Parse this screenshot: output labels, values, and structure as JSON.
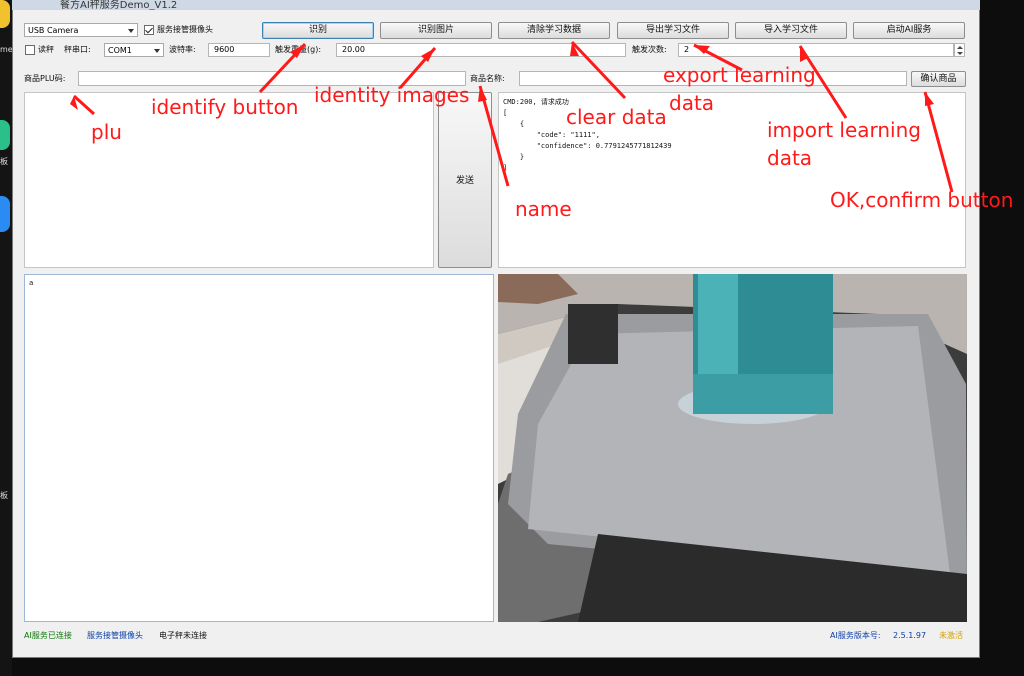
{
  "window": {
    "title": "餐方AI秤服务Demo_V1.2"
  },
  "toolbar": {
    "camera_select": "USB Camera",
    "service_camera_checkbox": {
      "label": "服务接管摄像头",
      "checked": true
    },
    "read_scale_checkbox": {
      "label": "读秤",
      "checked": false
    },
    "serial_port_label": "秤串口:",
    "serial_port_select": "COM1",
    "baud_rate_label": "波特率:",
    "baud_rate_value": "9600",
    "trigger_weight_label": "触发重量(g):",
    "trigger_weight_value": "20.00",
    "trigger_count_label": "触发次数:",
    "trigger_count_value": "2",
    "buttons": {
      "identify": "识别",
      "identify_image": "识别图片",
      "clear_data": "清除学习数据",
      "export_file": "导出学习文件",
      "import_file": "导入学习文件",
      "start_service": "启动AI服务"
    }
  },
  "product": {
    "plu_label": "商品PLU码:",
    "plu_value": "",
    "name_label": "商品名称:",
    "name_value": "",
    "confirm_button": "确认商品",
    "send_button": "发送"
  },
  "response": {
    "lines": [
      "CMD:200, 请求成功",
      "[",
      "    {",
      "        \"code\": \"1111\",",
      "        \"confidence\": 0.7791245771812439",
      "    }",
      "]"
    ]
  },
  "log": {
    "text": "a"
  },
  "status": {
    "ai_service": "AI服务已连接",
    "camera": "服务接管摄像头",
    "scale": "电子秤未连接",
    "version_label": "AI服务版本号:",
    "version_value": "2.5.1.97",
    "activation": "未激活"
  },
  "annotations": {
    "identify_button": "identify button",
    "identity_images": "identity images",
    "plu": "plu",
    "clear_data": "clear data",
    "export_line1": "export learning",
    "export_line2": "data",
    "import_line1": "import learning",
    "import_line2": "data",
    "name": "name",
    "confirm": "OK,confirm button"
  },
  "dock": {
    "label1": "me",
    "label2": "板",
    "label3": "板"
  },
  "colors": {
    "annotation": "#ff1a1a",
    "status_connected": "#0a7a0a",
    "status_info": "#0b3fa8",
    "status_inactive": "#d4a000"
  }
}
